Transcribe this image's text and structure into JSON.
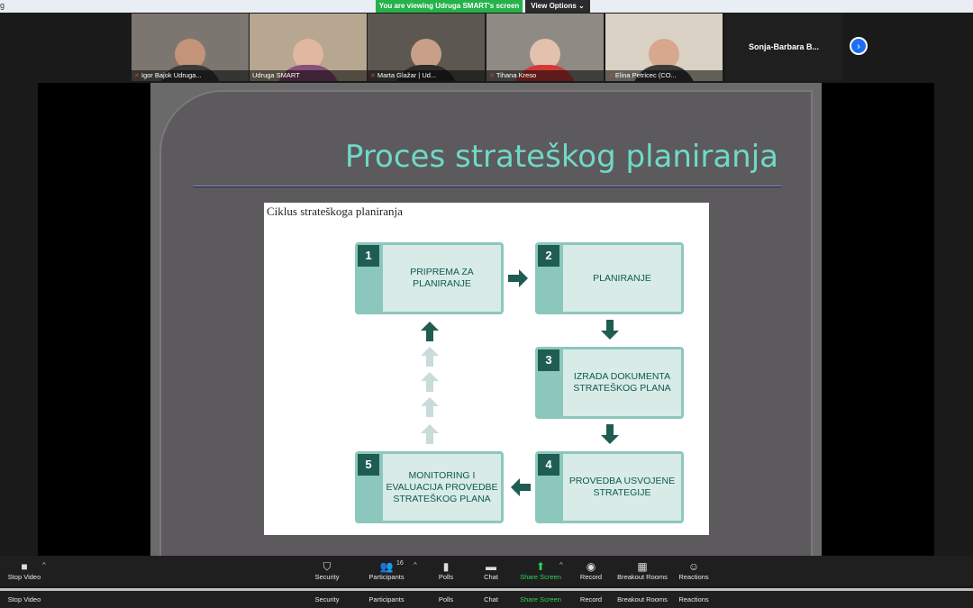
{
  "window": {
    "title_fragment": "g"
  },
  "banner": {
    "viewing_text": "You are viewing Udruga SMART's screen",
    "view_options_label": "View Options"
  },
  "participants_tiles": [
    {
      "name": "Igor Bajok Udruga...",
      "muted": true,
      "bg": "#7b7770",
      "body": "#3a3a3a",
      "hair": "#3b2a20"
    },
    {
      "name": "Udruga SMART",
      "muted": false,
      "bg": "#b7a690",
      "body": "#8a4f7a",
      "hair": "#d9c090"
    },
    {
      "name": "Marta Glažar | Ud...",
      "muted": true,
      "bg": "#5c5750",
      "body": "#2c2c2c",
      "hair": "#2a1d15"
    },
    {
      "name": "Tihana Kreso",
      "muted": true,
      "bg": "#8f8a84",
      "body": "#d23a3a",
      "hair": "#d9d2c5"
    },
    {
      "name": "Elina Petricec (CO...",
      "muted": true,
      "bg": "#d9d1c3",
      "body": "#3a3a3a",
      "hair": "#5a3a25"
    }
  ],
  "name_only_tile": {
    "name": "Sonja-Barbara  B..."
  },
  "slide": {
    "title": "Proces strateškog planiranja",
    "figure_caption": "Ciklus strateškoga planiranja",
    "steps": [
      {
        "num": "1",
        "label": "PRIPREMA ZA PLANIRANJE"
      },
      {
        "num": "2",
        "label": "PLANIRANJE"
      },
      {
        "num": "3",
        "label": "IZRADA DOKUMENTA STRATEŠKOG PLANA"
      },
      {
        "num": "4",
        "label": "PROVEDBA USVOJENE STRATEGIJE"
      },
      {
        "num": "5",
        "label": "MONITORING I EVALUACIJA PROVEDBE STRATEŠKOG PLANA"
      }
    ]
  },
  "toolbar": {
    "stop_video": "Stop Video",
    "security": "Security",
    "participants": "Participants",
    "participants_count": "16",
    "polls": "Polls",
    "chat": "Chat",
    "share_screen": "Share Screen",
    "record": "Record",
    "breakout_rooms": "Breakout Rooms",
    "reactions": "Reactions"
  },
  "colors": {
    "share_green": "#2fd15a",
    "title_teal": "#6fd9c8",
    "step_dark": "#1f5c52",
    "step_light": "#8cc7bd"
  }
}
